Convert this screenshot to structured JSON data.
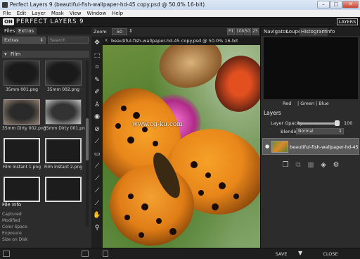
{
  "window": {
    "title": "Perfect Layers 9 (beautiful-fish-wallpaper-hd-45 copy.psd @ 50.0% 16-bit)",
    "controls": [
      "–",
      "□",
      "✕"
    ]
  },
  "menubar": {
    "items": [
      "File",
      "Edit",
      "Layer",
      "Mask",
      "View",
      "Window",
      "Help"
    ]
  },
  "header": {
    "logo_badge": "ON",
    "logo_text": "PERFECT LAYERS 9",
    "layers_button": "LAYERS"
  },
  "left_panel": {
    "tabs": [
      "Files",
      "Extras"
    ],
    "filter_dropdown": "Extras",
    "search_placeholder": "Search",
    "folder": "Film",
    "thumbnails": [
      {
        "label": "35mm 001.png",
        "style": "dark"
      },
      {
        "label": "35mm 002.png",
        "style": "dark"
      },
      {
        "label": "35mm Dirty 002.png",
        "style": "dirty"
      },
      {
        "label": "35mm Dirty 001.png",
        "style": "dirty-light"
      },
      {
        "label": "Film Instant 1.png",
        "style": "instant"
      },
      {
        "label": "Film Instant 2.png",
        "style": "instant"
      },
      {
        "label": "",
        "style": "instant"
      },
      {
        "label": "",
        "style": "instant"
      }
    ],
    "file_info_title": "File Info",
    "file_info_fields": [
      "Captured",
      "Modified",
      "Color Space",
      "Exposure",
      "Size on Disk"
    ]
  },
  "zoom": {
    "label": "Zoom",
    "value": "50",
    "buttons": [
      "Fit",
      "100",
      "50",
      "25"
    ]
  },
  "document_tab": {
    "close": "x",
    "title": "beautiful-fish-wallpaper-hd-45 copy.psd @ 50.0% 16-bit"
  },
  "canvas": {
    "watermark": "www.cg-ku.com"
  },
  "tools": [
    {
      "name": "move-tool-icon",
      "glyph": "✥"
    },
    {
      "name": "transform-tool-icon",
      "glyph": "⬚"
    },
    {
      "name": "crop-tool-icon",
      "glyph": "⌗"
    },
    {
      "name": "brush-tool-icon",
      "glyph": "✎"
    },
    {
      "name": "eraser-tool-icon",
      "glyph": "✐"
    },
    {
      "name": "stamp-tool-icon",
      "glyph": "♙"
    },
    {
      "name": "eye-tool-icon",
      "glyph": "◉"
    },
    {
      "name": "masking-brush-icon",
      "glyph": "⊘"
    },
    {
      "name": "quick-mask-icon",
      "glyph": "⟋"
    },
    {
      "name": "gradient-mask-icon",
      "glyph": "▭"
    },
    {
      "name": "retouch-brush-icon",
      "glyph": "⟋"
    },
    {
      "name": "clone-brush-icon",
      "glyph": "⟋"
    },
    {
      "name": "selection-brush-icon",
      "glyph": "⟋"
    },
    {
      "name": "smudge-brush-icon",
      "glyph": "⟋"
    },
    {
      "name": "hand-tool-icon",
      "glyph": "✋"
    },
    {
      "name": "zoom-tool-icon",
      "glyph": "⚲"
    }
  ],
  "right_panel": {
    "tabs": [
      "Navigator",
      "Loupe",
      "Histogram",
      "Info"
    ],
    "active_tab": "Histogram",
    "channels": [
      "Red",
      "| Green",
      "| Blue"
    ],
    "layers_title": "Layers",
    "opacity_label": "Layer Opacity",
    "opacity_value": "100",
    "opacity_level": 1.0,
    "blending_label": "Blending",
    "blending_value": "Normal",
    "layer_name": "beautiful-fish-wallpaper-hd-45"
  },
  "bottom_bar": {
    "save_label": "SAVE",
    "save_menu_glyph": "▼",
    "close_label": "CLOSE"
  },
  "colors": {
    "panel_bg": "#2c2c2c",
    "dark_bar": "#1f1f1f",
    "butterfly_orange": "#e8861a"
  }
}
